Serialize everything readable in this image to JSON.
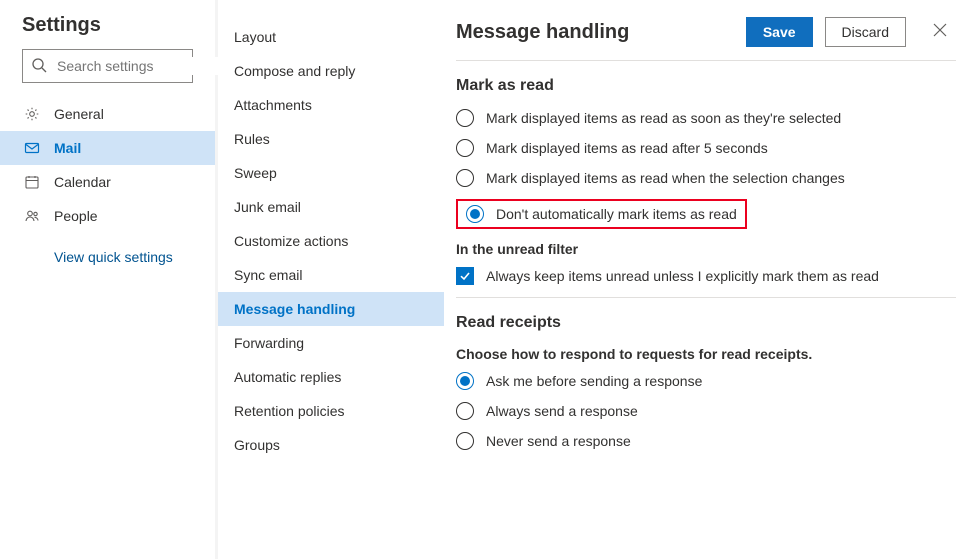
{
  "left": {
    "title": "Settings",
    "search_placeholder": "Search settings",
    "items": [
      {
        "label": "General"
      },
      {
        "label": "Mail"
      },
      {
        "label": "Calendar"
      },
      {
        "label": "People"
      }
    ],
    "quick_link": "View quick settings"
  },
  "middle": {
    "items": [
      {
        "label": "Layout"
      },
      {
        "label": "Compose and reply"
      },
      {
        "label": "Attachments"
      },
      {
        "label": "Rules"
      },
      {
        "label": "Sweep"
      },
      {
        "label": "Junk email"
      },
      {
        "label": "Customize actions"
      },
      {
        "label": "Sync email"
      },
      {
        "label": "Message handling"
      },
      {
        "label": "Forwarding"
      },
      {
        "label": "Automatic replies"
      },
      {
        "label": "Retention policies"
      },
      {
        "label": "Groups"
      }
    ]
  },
  "right": {
    "title": "Message handling",
    "save_label": "Save",
    "discard_label": "Discard",
    "mark_as_read": {
      "title": "Mark as read",
      "options": [
        "Mark displayed items as read as soon as they're selected",
        "Mark displayed items as read after 5 seconds",
        "Mark displayed items as read when the selection changes",
        "Don't automatically mark items as read"
      ],
      "filter_title": "In the unread filter",
      "filter_option": "Always keep items unread unless I explicitly mark them as read"
    },
    "read_receipts": {
      "title": "Read receipts",
      "subtitle": "Choose how to respond to requests for read receipts.",
      "options": [
        "Ask me before sending a response",
        "Always send a response",
        "Never send a response"
      ]
    }
  }
}
